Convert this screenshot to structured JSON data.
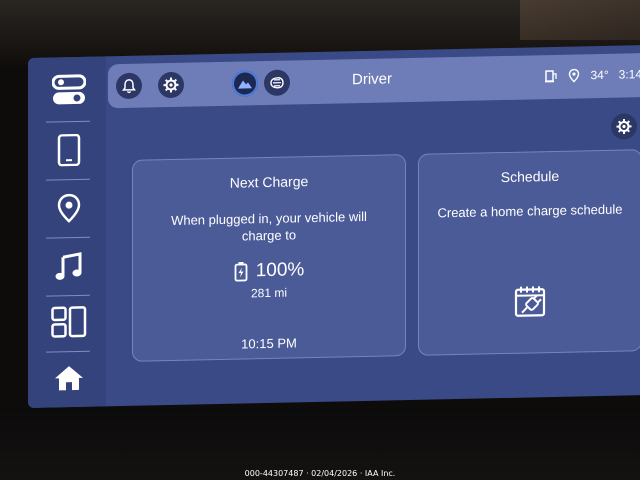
{
  "header": {
    "profile_name": "Driver",
    "temperature": "34°",
    "time": "3:14"
  },
  "sidebar": {
    "items": [
      {
        "icon": "toggle-icon"
      },
      {
        "icon": "phone-icon"
      },
      {
        "icon": "location-pin-icon"
      },
      {
        "icon": "music-note-icon"
      },
      {
        "icon": "apps-grid-icon"
      },
      {
        "icon": "home-icon"
      }
    ]
  },
  "next_charge": {
    "title": "Next Charge",
    "message": "When plugged in, your vehicle will charge to",
    "percent": "100%",
    "range": "281 mi",
    "time": "10:15 PM"
  },
  "schedule": {
    "title": "Schedule",
    "message": "Create a home charge schedule"
  },
  "watermark": "000-44307487 · 02/04/2026 · IAA Inc.",
  "colors": {
    "screen_bg": "#3a4a86",
    "card_bg": "#4b5b98",
    "statusbar_bg": "#6e7db8",
    "accent_blue": "#4a7de0"
  }
}
